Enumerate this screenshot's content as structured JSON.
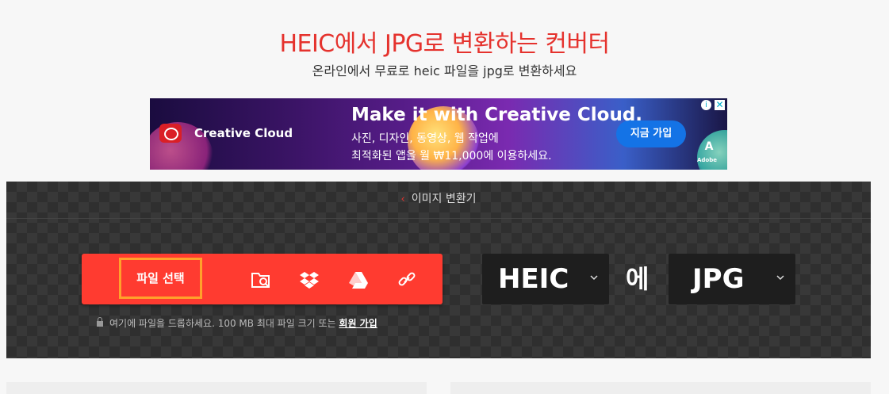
{
  "header": {
    "title": "HEIC에서 JPG로 변환하는 컨버터",
    "subtitle": "온라인에서 무료로 heic 파일을 jpg로 변환하세요"
  },
  "ad": {
    "brand": "Creative Cloud",
    "headline": "Make it with Creative Cloud.",
    "line1": "사진, 디자인, 동영상, 웹 작업에",
    "line2": "최적화된 앱을 월 ₩11,000에 이용하세요.",
    "cta": "지금 가입",
    "adobe_mark": "A",
    "adobe_text": "Adobe",
    "info_icon": "i",
    "close_icon": "✕"
  },
  "converter": {
    "breadcrumb_icon": "‹",
    "breadcrumb": "이미지 변환기",
    "choose_file": "파일 선택",
    "sources": [
      "device-folder-icon",
      "dropbox-icon",
      "google-drive-icon",
      "url-link-icon"
    ],
    "drop_hint": "여기에 파일을 드롭하세요. 100 MB 최대 파일 크기 또는",
    "signup_link": "회원 가입",
    "from_format": "HEIC",
    "to_word": "에",
    "to_format": "JPG"
  },
  "colors": {
    "brand_red": "#e5322d",
    "button_red": "#ff3b30",
    "highlight_orange": "#ffa12b",
    "panel_bg": "#2f2f2f"
  }
}
